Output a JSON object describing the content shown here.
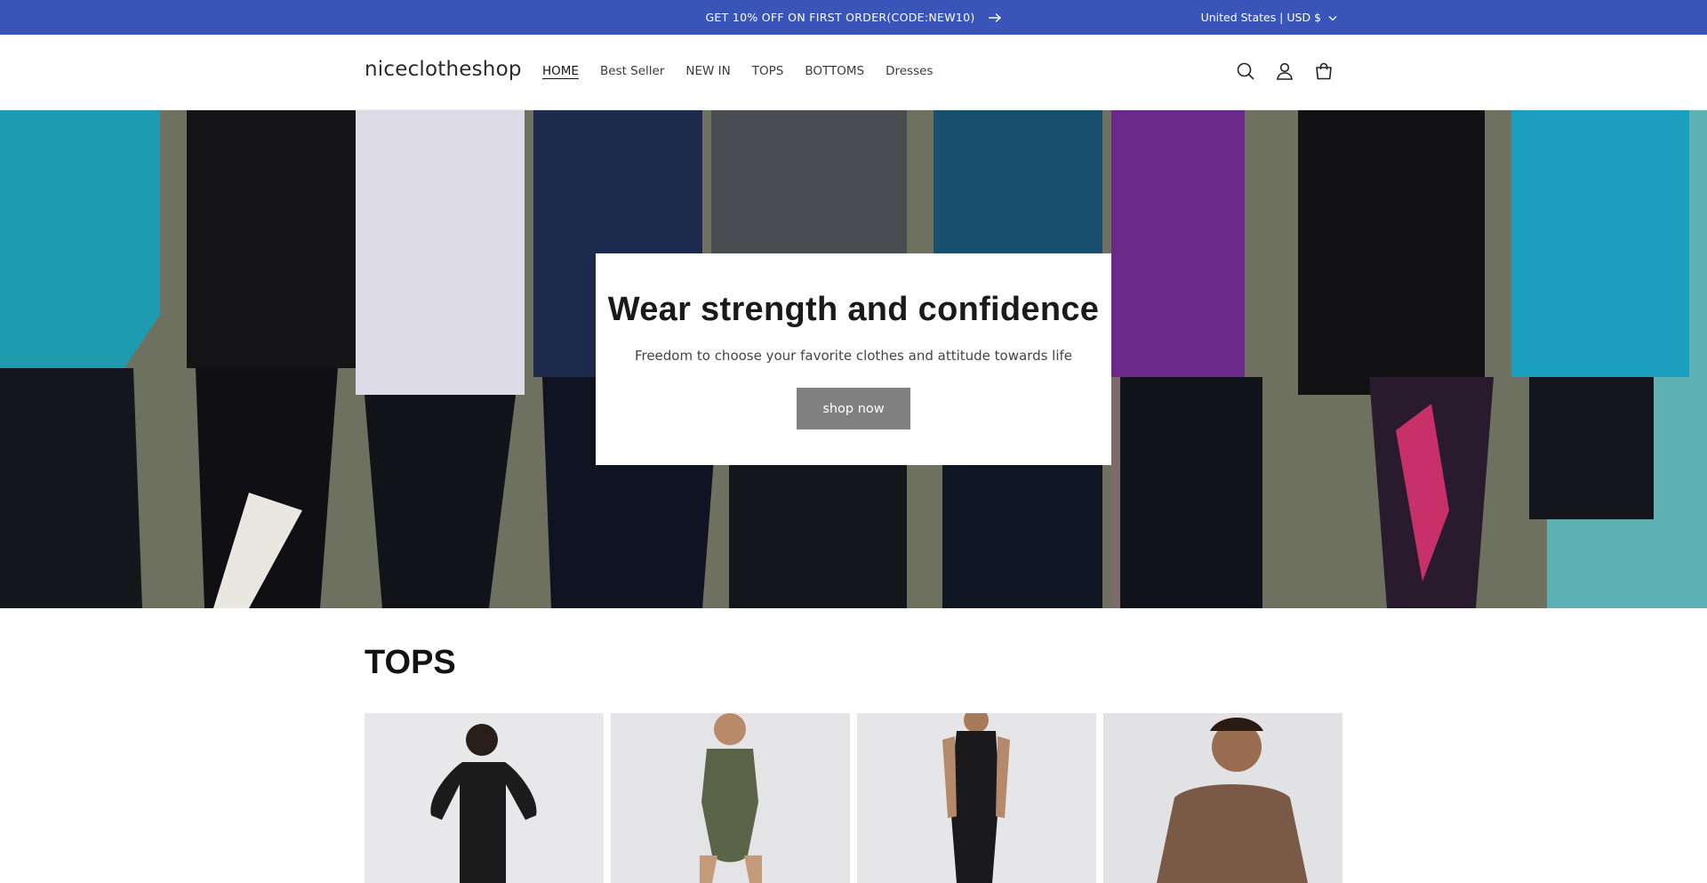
{
  "announcement": {
    "message": "GET 10% OFF ON FIRST ORDER(CODE:NEW10)",
    "arrow_icon": "arrow-right-icon",
    "locale": "United States | USD $",
    "background": "#3a55b9"
  },
  "header": {
    "logo": "niceclotheshop",
    "nav": [
      {
        "label": "HOME",
        "active": true
      },
      {
        "label": "Best Seller"
      },
      {
        "label": "NEW IN"
      },
      {
        "label": "TOPS"
      },
      {
        "label": "BOTTOMS"
      },
      {
        "label": "Dresses"
      }
    ],
    "icons": [
      "search-icon",
      "account-icon",
      "cart-icon"
    ]
  },
  "hero": {
    "title": "Wear strength and confidence",
    "subtitle": "Freedom to choose your favorite clothes and attitude towards life",
    "button_label": "shop now",
    "button_color": "#808080"
  },
  "section": {
    "title": "TOPS",
    "products": [
      {
        "color": "#1f1f1f"
      },
      {
        "color": "#5c6447"
      },
      {
        "color": "#1a1a1c"
      },
      {
        "color": "#7a5a46"
      }
    ]
  }
}
